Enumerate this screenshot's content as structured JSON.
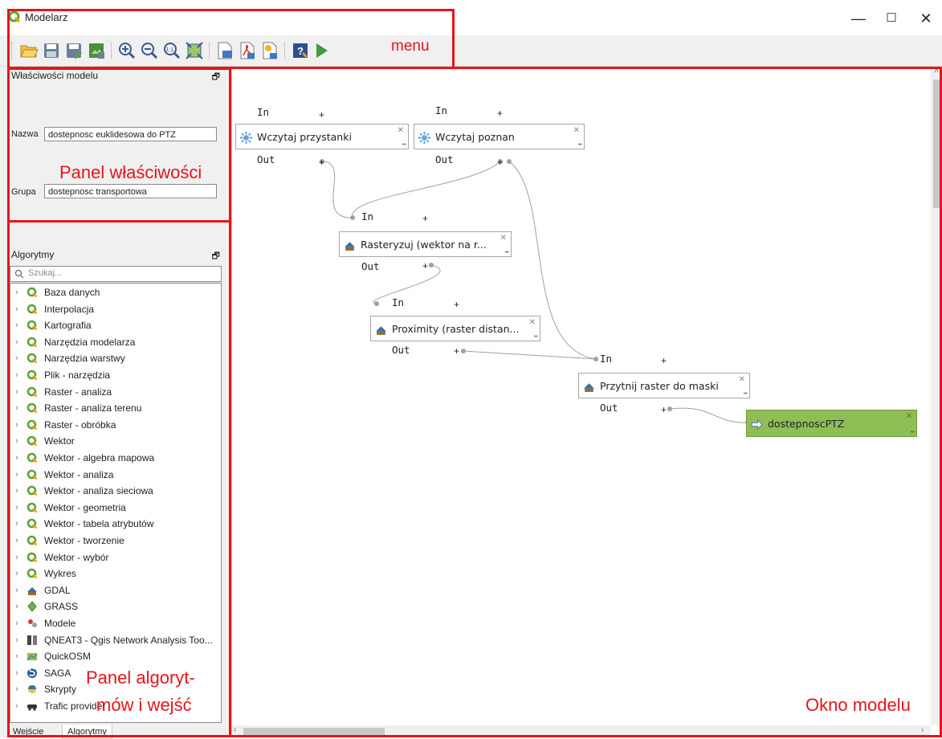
{
  "window": {
    "title": "Modelarz",
    "minimize": "—",
    "maximize": "☐",
    "close": "✕"
  },
  "toolbar": {
    "items": [
      "open-model-icon",
      "save-model-icon",
      "save-model-as-icon",
      "save-to-project-icon",
      "zoom-in-icon",
      "zoom-out-icon",
      "zoom-actual-icon",
      "zoom-full-icon",
      "export-image-icon",
      "export-pdf-icon",
      "export-svg-icon",
      "help-icon",
      "run-model-icon"
    ]
  },
  "properties": {
    "header": "Właściwości modelu",
    "name_label": "Nazwa",
    "name_value": "dostepnosc euklidesowa do PTZ",
    "group_label": "Grupa",
    "group_value": "dostepnosc transportowa"
  },
  "algorithms": {
    "header": "Algorytmy",
    "search_placeholder": "Szukaj...",
    "items": [
      {
        "label": "Baza danych",
        "icon": "qgis-icon"
      },
      {
        "label": "Interpolacja",
        "icon": "qgis-icon"
      },
      {
        "label": "Kartografia",
        "icon": "qgis-icon"
      },
      {
        "label": "Narzędzia modelarza",
        "icon": "qgis-icon"
      },
      {
        "label": "Narzędzia warstwy",
        "icon": "qgis-icon"
      },
      {
        "label": "Plik - narzędzia",
        "icon": "qgis-icon"
      },
      {
        "label": "Raster - analiza",
        "icon": "qgis-icon"
      },
      {
        "label": "Raster - analiza terenu",
        "icon": "qgis-icon"
      },
      {
        "label": "Raster - obróbka",
        "icon": "qgis-icon"
      },
      {
        "label": "Wektor",
        "icon": "qgis-icon"
      },
      {
        "label": "Wektor - algebra mapowa",
        "icon": "qgis-icon"
      },
      {
        "label": "Wektor - analiza",
        "icon": "qgis-icon"
      },
      {
        "label": "Wektor - analiza sieciowa",
        "icon": "qgis-icon"
      },
      {
        "label": "Wektor - geometria",
        "icon": "qgis-icon"
      },
      {
        "label": "Wektor - tabela atrybutów",
        "icon": "qgis-icon"
      },
      {
        "label": "Wektor - tworzenie",
        "icon": "qgis-icon"
      },
      {
        "label": "Wektor - wybór",
        "icon": "qgis-icon"
      },
      {
        "label": "Wykres",
        "icon": "qgis-icon"
      },
      {
        "label": "GDAL",
        "icon": "gdal-icon"
      },
      {
        "label": "GRASS",
        "icon": "grass-icon"
      },
      {
        "label": "Modele",
        "icon": "models-icon"
      },
      {
        "label": "QNEAT3 - Qgis Network Analysis Too...",
        "icon": "qneat3-icon"
      },
      {
        "label": "QuickOSM",
        "icon": "quickosm-icon"
      },
      {
        "label": "SAGA",
        "icon": "saga-icon"
      },
      {
        "label": "Skrypty",
        "icon": "python-icon"
      },
      {
        "label": "Trafic provider",
        "icon": "car-icon"
      }
    ]
  },
  "tabs": [
    "Wejście",
    "Algorytmy"
  ],
  "model": {
    "port_in": "In",
    "port_out": "Out",
    "plus": "+",
    "nodes": {
      "input1": "Wczytaj przystanki",
      "input2": "Wczytaj poznan",
      "rasterize": "Rasteryzuj (wektor na r...",
      "proximity": "Proximity (raster distan...",
      "clip": "Przytnij raster do maski",
      "output": "dostepnoscPTZ"
    }
  },
  "annotations": {
    "menu": "menu",
    "properties": "Panel właściwości",
    "algorithms_line1": "Panel algoryt-",
    "algorithms_line2": "mów i wejść",
    "canvas": "Okno modelu"
  },
  "colors": {
    "annotation_red": "#e8141a",
    "output_node_green": "#8fbd56",
    "qgis_green": "#5ba335"
  }
}
